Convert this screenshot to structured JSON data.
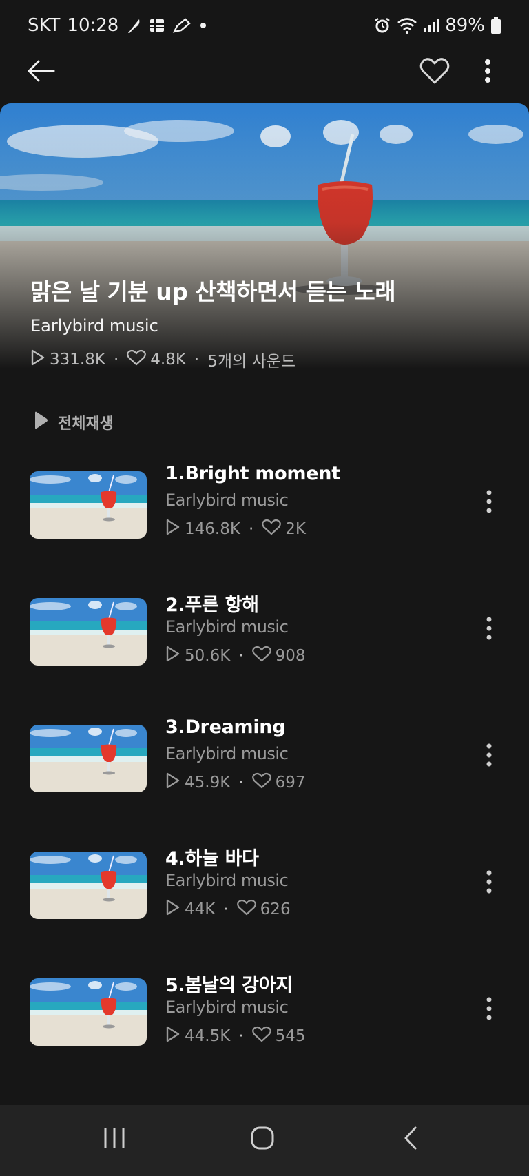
{
  "status_bar": {
    "carrier": "SKT",
    "time": "10:28",
    "battery": "89%",
    "icons": [
      "feather-icon",
      "grid-icon",
      "pencil-icon",
      "dot-icon",
      "alarm-icon",
      "wifi-icon",
      "signal-icon",
      "battery-icon"
    ]
  },
  "top_bar": {
    "back_icon": "arrow-left-icon",
    "like_icon": "heart-outline-icon",
    "more_icon": "more-vertical-icon"
  },
  "playlist": {
    "title": "맑은 날 기분 up 산책하면서 듣는 노래",
    "artist": "Earlybird music",
    "plays": "331.8K",
    "likes": "4.8K",
    "sound_count": "5개의 사운드"
  },
  "play_all": {
    "label": "전체재생"
  },
  "tracks": [
    {
      "title": "1.Bright moment",
      "artist": "Earlybird music",
      "plays": "146.8K",
      "likes": "2K"
    },
    {
      "title": "2.푸른 항해",
      "artist": "Earlybird music",
      "plays": "50.6K",
      "likes": "908"
    },
    {
      "title": "3.Dreaming",
      "artist": "Earlybird music",
      "plays": "45.9K",
      "likes": "697"
    },
    {
      "title": "4.하늘 바다",
      "artist": "Earlybird music",
      "plays": "44K",
      "likes": "626"
    },
    {
      "title": "5.봄날의 강아지",
      "artist": "Earlybird music",
      "plays": "44.5K",
      "likes": "545"
    }
  ],
  "nav_bar": {
    "recents_icon": "recents-icon",
    "home_icon": "home-icon",
    "back_icon": "back-chevron-icon"
  },
  "colors": {
    "background": "#161616",
    "nav_background": "#232323",
    "secondary_text": "#9a9a9a"
  }
}
